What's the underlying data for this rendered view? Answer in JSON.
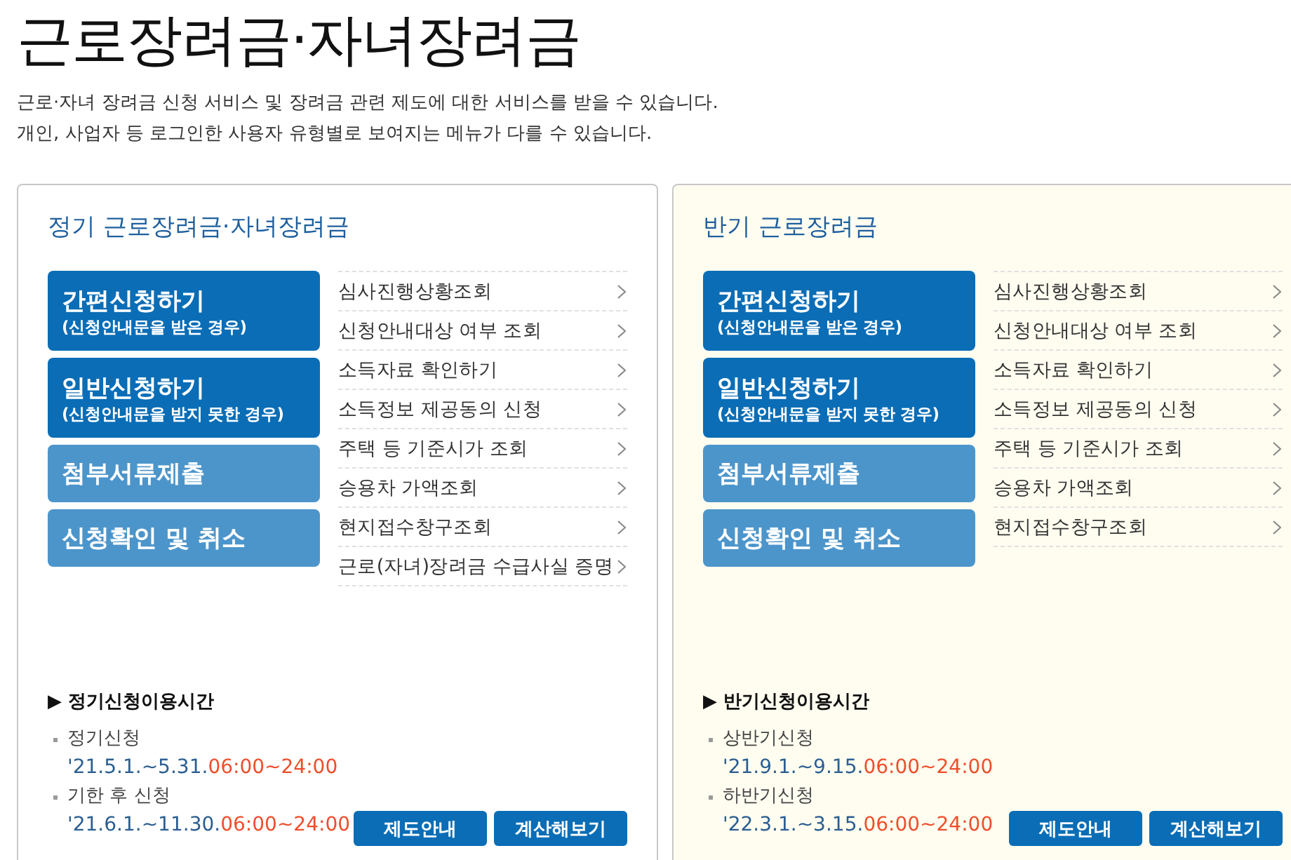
{
  "page": {
    "title": "근로장려금·자녀장려금",
    "description": [
      "근로·자녀 장려금 신청 서비스 및 장려금 관련 제도에 대한 서비스를 받을 수 있습니다.",
      "개인, 사업자 등 로그인한 사용자 유형별로 보여지는 메뉴가 다를 수 있습니다."
    ]
  },
  "panels": [
    {
      "title": "정기 근로장려금·자녀장려금",
      "color": "#ffffff",
      "actions": [
        {
          "label": "간편신청하기",
          "note": "(신청안내문을 받은 경우)",
          "kind": "primary"
        },
        {
          "label": "일반신청하기",
          "note": "(신청안내문을 받지 못한 경우)",
          "kind": "primary"
        },
        {
          "label": "첨부서류제출",
          "kind": "secondary"
        },
        {
          "label": "신청확인 및 취소",
          "kind": "secondary"
        }
      ],
      "links": [
        "심사진행상황조회",
        "신청안내대상 여부 조회",
        "소득자료 확인하기",
        "소득정보 제공동의 신청",
        "주택 등 기준시가 조회",
        "승용차 가액조회",
        "현지접수창구조회",
        "근로(자녀)장려금 수급사실 증명"
      ],
      "schedule": {
        "heading": "▶ 정기신청이용시간",
        "items": [
          {
            "label": "정기신청",
            "dates": "'21.5.1.~5.31.",
            "hours": "06:00~24:00"
          },
          {
            "label": "기한 후 신청",
            "dates": "'21.6.1.~11.30.",
            "hours": "06:00~24:00"
          }
        ]
      },
      "buttons": [
        "제도안내",
        "계산해보기"
      ]
    },
    {
      "title": "반기 근로장려금",
      "color": "#fffdf0",
      "actions": [
        {
          "label": "간편신청하기",
          "note": "(신청안내문을 받은 경우)",
          "kind": "primary"
        },
        {
          "label": "일반신청하기",
          "note": "(신청안내문을 받지 못한 경우)",
          "kind": "primary"
        },
        {
          "label": "첨부서류제출",
          "kind": "secondary"
        },
        {
          "label": "신청확인 및 취소",
          "kind": "secondary"
        }
      ],
      "links": [
        "심사진행상황조회",
        "신청안내대상 여부 조회",
        "소득자료 확인하기",
        "소득정보 제공동의 신청",
        "주택 등 기준시가 조회",
        "승용차 가액조회",
        "현지접수창구조회"
      ],
      "schedule": {
        "heading": "▶ 반기신청이용시간",
        "items": [
          {
            "label": "상반기신청",
            "dates": "'21.9.1.~9.15.",
            "hours": "06:00~24:00"
          },
          {
            "label": "하반기신청",
            "dates": "'22.3.1.~3.15.",
            "hours": "06:00~24:00"
          }
        ]
      },
      "buttons": [
        "제도안내",
        "계산해보기"
      ]
    }
  ]
}
